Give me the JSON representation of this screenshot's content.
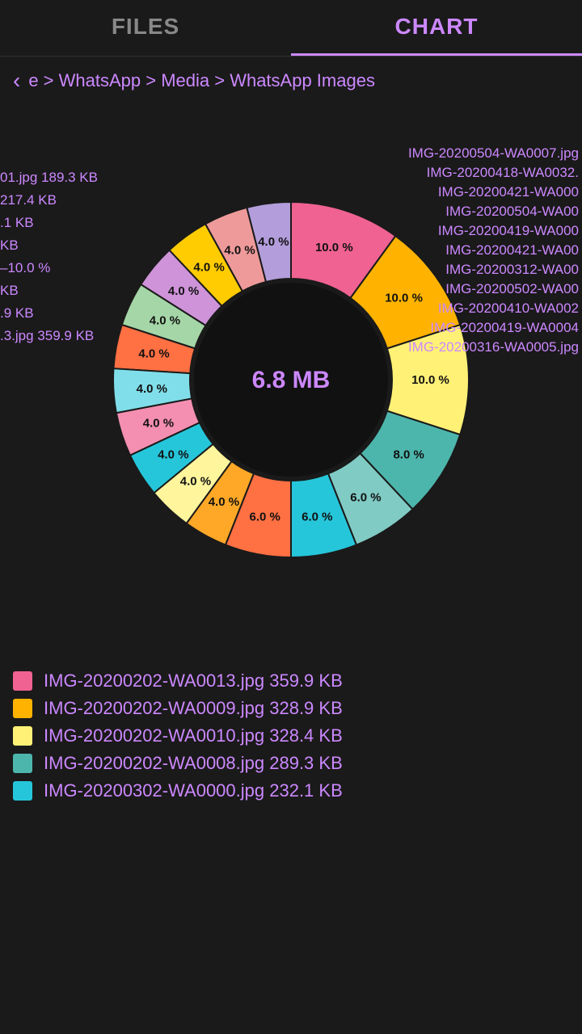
{
  "tabs": [
    {
      "id": "files",
      "label": "FILES",
      "active": false
    },
    {
      "id": "chart",
      "label": "CHART",
      "active": true
    }
  ],
  "breadcrumb": {
    "back_label": "‹",
    "path": "e > WhatsApp > Media > WhatsApp Images"
  },
  "chart": {
    "center_value": "6.8 MB",
    "slices": [
      {
        "color": "#f06292",
        "percent": 10.0,
        "label": "10.0 %"
      },
      {
        "color": "#ffb300",
        "percent": 10.0,
        "label": "10.0 %"
      },
      {
        "color": "#fff176",
        "percent": 10.0,
        "label": "10.0 %"
      },
      {
        "color": "#4db6ac",
        "percent": 8.0,
        "label": "8.0 %"
      },
      {
        "color": "#80cbc4",
        "percent": 6.0,
        "label": "6.0 %"
      },
      {
        "color": "#26c6da",
        "percent": 6.0,
        "label": "6.0 %"
      },
      {
        "color": "#ff7043",
        "percent": 6.0,
        "label": "6.0 %"
      },
      {
        "color": "#ffa726",
        "percent": 4.0,
        "label": "4.0 %"
      },
      {
        "color": "#fff59d",
        "percent": 4.0,
        "label": "4.0 %"
      },
      {
        "color": "#26c6da",
        "percent": 4.0,
        "label": "4.0 %"
      },
      {
        "color": "#f48fb1",
        "percent": 4.0,
        "label": "4.0 %"
      },
      {
        "color": "#80deea",
        "percent": 4.0,
        "label": "4.0 %"
      },
      {
        "color": "#ff7043",
        "percent": 4.0,
        "label": "4.0 %"
      },
      {
        "color": "#a5d6a7",
        "percent": 4.0,
        "label": "4.0 %"
      },
      {
        "color": "#ce93d8",
        "percent": 4.0,
        "label": "4.0 %"
      },
      {
        "color": "#ffcc02",
        "percent": 4.0,
        "label": "4.0 %"
      },
      {
        "color": "#ef9a9a",
        "percent": 4.0,
        "label": "4.0 %"
      },
      {
        "color": "#b39ddb",
        "percent": 4.0,
        "label": "4.0 %"
      }
    ]
  },
  "right_labels": [
    "IMG-20200504-WA0007.jpg",
    "IMG-20200418-WA0032.",
    "IMG-20200421-WA000",
    "IMG-20200504-WA00",
    "IMG-20200419-WA000",
    "IMG-20200421-WA00",
    "IMG-20200312-WA00",
    "IMG-20200502-WA00",
    "IMG-20200410-WA002",
    "IMG-20200419-WA0004",
    "IMG-20200316-WA0005.jpg"
  ],
  "left_labels": [
    "01.jpg 189.3 KB",
    "217.4 KB",
    ".1 KB",
    "KB",
    "–10.0 %",
    "KB",
    ".9 KB",
    ".3.jpg 359.9 KB"
  ],
  "legend": [
    {
      "color": "#f06292",
      "label": "IMG-20200202-WA0013.jpg 359.9 KB"
    },
    {
      "color": "#ffb300",
      "label": "IMG-20200202-WA0009.jpg 328.9 KB"
    },
    {
      "color": "#fff176",
      "label": "IMG-20200202-WA0010.jpg 328.4 KB"
    },
    {
      "color": "#4db6ac",
      "label": "IMG-20200202-WA0008.jpg 289.3 KB"
    },
    {
      "color": "#26c6da",
      "label": "IMG-20200302-WA0000.jpg 232.1 KB"
    }
  ]
}
